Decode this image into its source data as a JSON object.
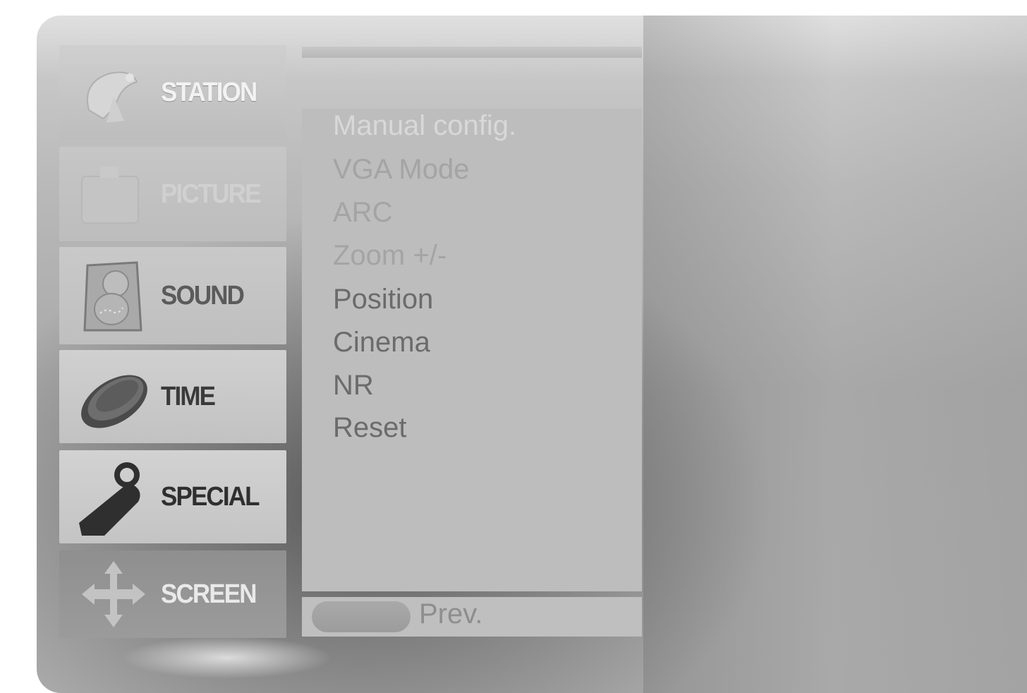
{
  "sidebar": {
    "items": [
      {
        "id": "station",
        "label": "STATION",
        "icon": "satellite-dish-icon"
      },
      {
        "id": "picture",
        "label": "PICTURE",
        "icon": "tv-icon"
      },
      {
        "id": "sound",
        "label": "SOUND",
        "icon": "speaker-icon"
      },
      {
        "id": "time",
        "label": "TIME",
        "icon": "clock-icon"
      },
      {
        "id": "special",
        "label": "SPECIAL",
        "icon": "tag-icon"
      },
      {
        "id": "screen",
        "label": "SCREEN",
        "icon": "move-arrows-icon"
      }
    ],
    "selected": "screen"
  },
  "menu": {
    "items": [
      "Manual config.",
      "VGA Mode",
      "ARC",
      "Zoom +/-",
      "Position",
      "Cinema",
      "NR",
      "Reset"
    ]
  },
  "footer": {
    "prev_label": "Prev."
  }
}
